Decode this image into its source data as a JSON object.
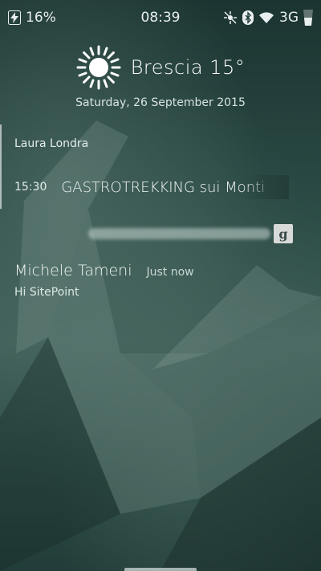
{
  "status_bar": {
    "battery_icon": "charging-bolt-icon",
    "battery_percent": "16%",
    "time": "08:39",
    "icons": [
      "no-gps-icon",
      "bluetooth-icon",
      "wifi-icon",
      "cellular-icon"
    ],
    "network_type": "3G"
  },
  "weather": {
    "icon": "sun-icon",
    "city_temp": "Brescia 15°",
    "date": "Saturday, 26 September 2015"
  },
  "notifications": {
    "sender": "Laura Londra",
    "event": {
      "time": "15:30",
      "title": "GASTROTREKKING sui Monti"
    },
    "search": {
      "button_glyph": "g"
    },
    "message": {
      "sender": "Michele Tameni",
      "time": "Just now",
      "body": "Hi SitePoint"
    }
  },
  "colors": {
    "background": "#1f3935",
    "text": "#ffffff",
    "accent": "#e3ecea"
  }
}
